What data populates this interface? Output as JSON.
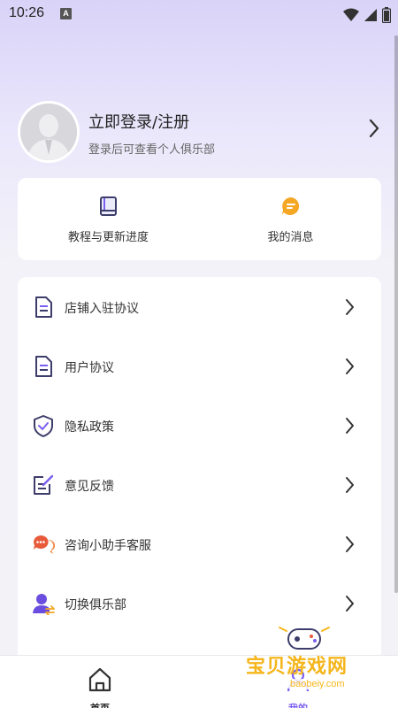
{
  "status_bar": {
    "time": "10:26",
    "notification_icon": "a-badge-icon",
    "wifi_icon": "wifi-icon",
    "signal_icon": "signal-icon",
    "battery_icon": "battery-icon"
  },
  "profile": {
    "title": "立即登录/注册",
    "subtitle": "登录后可查看个人俱乐部",
    "avatar_icon": "default-avatar-icon"
  },
  "quick": [
    {
      "label": "教程与更新进度",
      "icon": "book-icon"
    },
    {
      "label": "我的消息",
      "icon": "message-icon"
    }
  ],
  "menu": [
    {
      "label": "店铺入驻协议",
      "icon": "document-icon"
    },
    {
      "label": "用户协议",
      "icon": "document-icon"
    },
    {
      "label": "隐私政策",
      "icon": "shield-check-icon"
    },
    {
      "label": "意见反馈",
      "icon": "edit-icon"
    },
    {
      "label": "咨询小助手客服",
      "icon": "chat-bubbles-icon"
    },
    {
      "label": "切换俱乐部",
      "icon": "user-switch-icon"
    }
  ],
  "nav": {
    "home": "首页",
    "mine": "我的"
  },
  "watermark": {
    "text": "宝贝游戏网",
    "url": "baobeiy.com"
  },
  "colors": {
    "accent": "#7a5ff0",
    "icon_dark": "#3d3d6b",
    "message_orange": "#f5a623",
    "watermark": "#f5b61c"
  }
}
